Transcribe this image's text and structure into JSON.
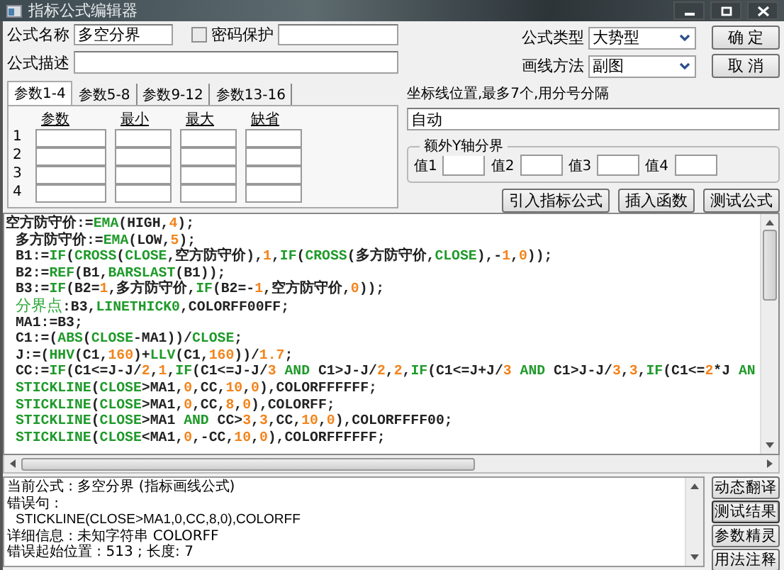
{
  "window": {
    "title": "指标公式编辑器"
  },
  "formula": {
    "name_label": "公式名称",
    "name": "多空分界",
    "password": {
      "label": "密码保护",
      "checked": false
    },
    "description_label": "公式描述"
  },
  "formula_type": {
    "label": "公式类型",
    "value": "大势型"
  },
  "draw_method": {
    "label": "画线方法",
    "value": "副图"
  },
  "dialog_buttons": [
    "确 定",
    "取 消"
  ],
  "tabs": [
    {
      "label": "参数1-4",
      "selected": true
    },
    {
      "label": "参数5-8",
      "selected": false
    },
    {
      "label": "参数9-12",
      "selected": false
    },
    {
      "label": "参数13-16",
      "selected": false
    }
  ],
  "param_table": {
    "columns": [
      "参数",
      "最小",
      "最大",
      "缺省"
    ],
    "rows": [
      "1",
      "2",
      "3",
      "4"
    ]
  },
  "axis_lines": {
    "label": "坐标线位置,最多7个,用分号分隔",
    "value": "自动"
  },
  "y_bounds": {
    "title": "额外Y轴分界",
    "fields": [
      "值1",
      "值2",
      "值3",
      "值4"
    ]
  },
  "tool_buttons": [
    "引入指标公式",
    "插入函数",
    "测试公式"
  ],
  "code_lines": [
    {
      "indent": false,
      "segments": [
        {
          "kind": "plain",
          "text": "空方防守价:="
        },
        {
          "kind": "func",
          "text": "EMA"
        },
        {
          "kind": "plain",
          "text": "(HIGH,"
        },
        {
          "kind": "num",
          "text": "4"
        },
        {
          "kind": "plain",
          "text": ");"
        }
      ]
    },
    {
      "indent": true,
      "segments": [
        {
          "kind": "plain",
          "text": "多方防守价:="
        },
        {
          "kind": "func",
          "text": "EMA"
        },
        {
          "kind": "plain",
          "text": "(LOW,"
        },
        {
          "kind": "num",
          "text": "5"
        },
        {
          "kind": "plain",
          "text": ");"
        }
      ]
    },
    {
      "indent": true,
      "segments": [
        {
          "kind": "plain",
          "text": "B1:="
        },
        {
          "kind": "func",
          "text": "IF"
        },
        {
          "kind": "plain",
          "text": "("
        },
        {
          "kind": "func",
          "text": "CROSS"
        },
        {
          "kind": "plain",
          "text": "("
        },
        {
          "kind": "func",
          "text": "CLOSE"
        },
        {
          "kind": "plain",
          "text": ",空方防守价),"
        },
        {
          "kind": "num",
          "text": "1"
        },
        {
          "kind": "plain",
          "text": ","
        },
        {
          "kind": "func",
          "text": "IF"
        },
        {
          "kind": "plain",
          "text": "("
        },
        {
          "kind": "func",
          "text": "CROSS"
        },
        {
          "kind": "plain",
          "text": "(多方防守价,"
        },
        {
          "kind": "func",
          "text": "CLOSE"
        },
        {
          "kind": "plain",
          "text": "),-"
        },
        {
          "kind": "num",
          "text": "1"
        },
        {
          "kind": "plain",
          "text": ","
        },
        {
          "kind": "num",
          "text": "0"
        },
        {
          "kind": "plain",
          "text": "));"
        }
      ]
    },
    {
      "indent": true,
      "segments": [
        {
          "kind": "plain",
          "text": "B2:="
        },
        {
          "kind": "func",
          "text": "REF"
        },
        {
          "kind": "plain",
          "text": "(B1,"
        },
        {
          "kind": "func",
          "text": "BARSLAST"
        },
        {
          "kind": "plain",
          "text": "(B1));"
        }
      ]
    },
    {
      "indent": true,
      "segments": [
        {
          "kind": "plain",
          "text": "B3:="
        },
        {
          "kind": "func",
          "text": "IF"
        },
        {
          "kind": "plain",
          "text": "(B2="
        },
        {
          "kind": "num",
          "text": "1"
        },
        {
          "kind": "plain",
          "text": ",多方防守价,"
        },
        {
          "kind": "func",
          "text": "IF"
        },
        {
          "kind": "plain",
          "text": "(B2=-"
        },
        {
          "kind": "num",
          "text": "1"
        },
        {
          "kind": "plain",
          "text": ",空方防守价,"
        },
        {
          "kind": "num",
          "text": "0"
        },
        {
          "kind": "plain",
          "text": "));"
        }
      ]
    },
    {
      "indent": true,
      "segments": [
        {
          "kind": "label",
          "text": "分界点"
        },
        {
          "kind": "plain",
          "text": ":B3,"
        },
        {
          "kind": "func",
          "text": "LINETHICK0"
        },
        {
          "kind": "plain",
          "text": ",COLORFF00FF;"
        }
      ]
    },
    {
      "indent": true,
      "segments": [
        {
          "kind": "plain",
          "text": "MA1:=B3;"
        }
      ]
    },
    {
      "indent": true,
      "segments": [
        {
          "kind": "plain",
          "text": "C1:=("
        },
        {
          "kind": "func",
          "text": "ABS"
        },
        {
          "kind": "plain",
          "text": "("
        },
        {
          "kind": "func",
          "text": "CLOSE"
        },
        {
          "kind": "plain",
          "text": "-MA1))/"
        },
        {
          "kind": "func",
          "text": "CLOSE"
        },
        {
          "kind": "plain",
          "text": ";"
        }
      ]
    },
    {
      "indent": true,
      "segments": [
        {
          "kind": "plain",
          "text": "J:=("
        },
        {
          "kind": "func",
          "text": "HHV"
        },
        {
          "kind": "plain",
          "text": "(C1,"
        },
        {
          "kind": "num",
          "text": "160"
        },
        {
          "kind": "plain",
          "text": ")+"
        },
        {
          "kind": "func",
          "text": "LLV"
        },
        {
          "kind": "plain",
          "text": "(C1,"
        },
        {
          "kind": "num",
          "text": "160"
        },
        {
          "kind": "plain",
          "text": "))/"
        },
        {
          "kind": "num",
          "text": "1.7"
        },
        {
          "kind": "plain",
          "text": ";"
        }
      ]
    },
    {
      "indent": true,
      "segments": [
        {
          "kind": "plain",
          "text": "CC:="
        },
        {
          "kind": "func",
          "text": "IF"
        },
        {
          "kind": "plain",
          "text": "(C1<=J-J/"
        },
        {
          "kind": "num",
          "text": "2"
        },
        {
          "kind": "plain",
          "text": ","
        },
        {
          "kind": "num",
          "text": "1"
        },
        {
          "kind": "plain",
          "text": ","
        },
        {
          "kind": "func",
          "text": "IF"
        },
        {
          "kind": "plain",
          "text": "(C1<=J-J/"
        },
        {
          "kind": "num",
          "text": "3"
        },
        {
          "kind": "func",
          "text": " AND"
        },
        {
          "kind": "plain",
          "text": " C1>J-J/"
        },
        {
          "kind": "num",
          "text": "2"
        },
        {
          "kind": "plain",
          "text": ","
        },
        {
          "kind": "num",
          "text": "2"
        },
        {
          "kind": "plain",
          "text": ","
        },
        {
          "kind": "func",
          "text": "IF"
        },
        {
          "kind": "plain",
          "text": "(C1<=J+J/"
        },
        {
          "kind": "num",
          "text": "3"
        },
        {
          "kind": "func",
          "text": " AND"
        },
        {
          "kind": "plain",
          "text": " C1>J-J/"
        },
        {
          "kind": "num",
          "text": "3"
        },
        {
          "kind": "plain",
          "text": ","
        },
        {
          "kind": "num",
          "text": "3"
        },
        {
          "kind": "plain",
          "text": ","
        },
        {
          "kind": "func",
          "text": "IF"
        },
        {
          "kind": "plain",
          "text": "(C1<="
        },
        {
          "kind": "num",
          "text": "2"
        },
        {
          "kind": "plain",
          "text": "*J "
        },
        {
          "kind": "func",
          "text": "AN"
        }
      ]
    },
    {
      "indent": true,
      "segments": [
        {
          "kind": "func",
          "text": "STICKLINE"
        },
        {
          "kind": "plain",
          "text": "("
        },
        {
          "kind": "func",
          "text": "CLOSE"
        },
        {
          "kind": "plain",
          "text": ">MA1,"
        },
        {
          "kind": "num",
          "text": "0"
        },
        {
          "kind": "plain",
          "text": ",CC,"
        },
        {
          "kind": "num",
          "text": "10"
        },
        {
          "kind": "plain",
          "text": ","
        },
        {
          "kind": "num",
          "text": "0"
        },
        {
          "kind": "plain",
          "text": "),COLORFFFFFF;"
        }
      ]
    },
    {
      "indent": true,
      "segments": [
        {
          "kind": "func",
          "text": "STICKLINE"
        },
        {
          "kind": "plain",
          "text": "("
        },
        {
          "kind": "func",
          "text": "CLOSE"
        },
        {
          "kind": "plain",
          "text": ">MA1,"
        },
        {
          "kind": "num",
          "text": "0"
        },
        {
          "kind": "plain",
          "text": ",CC,"
        },
        {
          "kind": "num",
          "text": "8"
        },
        {
          "kind": "plain",
          "text": ","
        },
        {
          "kind": "num",
          "text": "0"
        },
        {
          "kind": "plain",
          "text": "),COLORFF;"
        }
      ]
    },
    {
      "indent": true,
      "segments": [
        {
          "kind": "func",
          "text": "STICKLINE"
        },
        {
          "kind": "plain",
          "text": "("
        },
        {
          "kind": "func",
          "text": "CLOSE"
        },
        {
          "kind": "plain",
          "text": ">MA1 "
        },
        {
          "kind": "func",
          "text": "AND"
        },
        {
          "kind": "plain",
          "text": " CC>"
        },
        {
          "kind": "num",
          "text": "3"
        },
        {
          "kind": "plain",
          "text": ","
        },
        {
          "kind": "num",
          "text": "3"
        },
        {
          "kind": "plain",
          "text": ",CC,"
        },
        {
          "kind": "num",
          "text": "10"
        },
        {
          "kind": "plain",
          "text": ","
        },
        {
          "kind": "num",
          "text": "0"
        },
        {
          "kind": "plain",
          "text": "),COLORFFFF00;"
        }
      ]
    },
    {
      "indent": true,
      "segments": [
        {
          "kind": "func",
          "text": "STICKLINE"
        },
        {
          "kind": "plain",
          "text": "("
        },
        {
          "kind": "func",
          "text": "CLOSE"
        },
        {
          "kind": "plain",
          "text": "<MA1,"
        },
        {
          "kind": "num",
          "text": "0"
        },
        {
          "kind": "plain",
          "text": ",-CC,"
        },
        {
          "kind": "num",
          "text": "10"
        },
        {
          "kind": "plain",
          "text": ","
        },
        {
          "kind": "num",
          "text": "0"
        },
        {
          "kind": "plain",
          "text": "),COLORFFFFFF;"
        }
      ]
    }
  ],
  "output_lines": [
    {
      "indent": false,
      "text": "当前公式 : 多空分界 (指标画线公式)"
    },
    {
      "indent": false,
      "text": "错误句 :"
    },
    {
      "indent": true,
      "text": "STICKLINE(CLOSE>MA1,0,CC,8,0),COLORFF"
    },
    {
      "indent": false,
      "text": "详细信息 : 未知字符串 COLORFF"
    },
    {
      "indent": false,
      "text": "错误起始位置 : 513 ; 长度: 7"
    }
  ],
  "side_buttons": [
    {
      "label": "动态翻译",
      "focused": false
    },
    {
      "label": "测试结果",
      "focused": true
    },
    {
      "label": "参数精灵",
      "focused": false
    },
    {
      "label": "用法注释",
      "focused": false
    }
  ]
}
